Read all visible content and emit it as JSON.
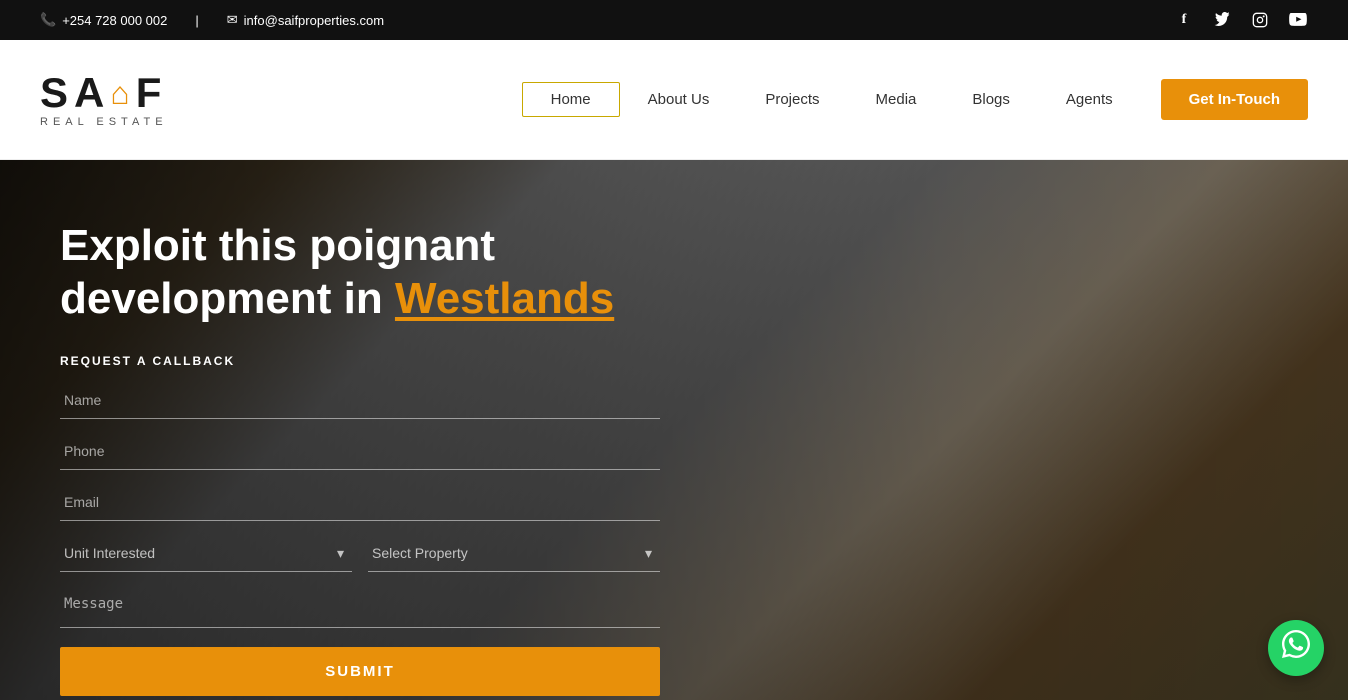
{
  "topbar": {
    "phone": "+254 728 000 002",
    "email": "info@saifproperties.com",
    "phone_icon": "📞",
    "email_icon": "✉",
    "socials": [
      {
        "name": "facebook",
        "icon": "f"
      },
      {
        "name": "twitter",
        "icon": "🐦"
      },
      {
        "name": "instagram",
        "icon": "📷"
      },
      {
        "name": "youtube",
        "icon": "▶"
      }
    ]
  },
  "header": {
    "logo_main": "SAIF",
    "logo_sub": "REAL ESTATE",
    "nav_items": [
      {
        "label": "Home",
        "active": true
      },
      {
        "label": "About Us",
        "active": false
      },
      {
        "label": "Projects",
        "active": false
      },
      {
        "label": "Media",
        "active": false
      },
      {
        "label": "Blogs",
        "active": false
      },
      {
        "label": "Agents",
        "active": false
      }
    ],
    "cta": "Get In-Touch"
  },
  "hero": {
    "title_part1": "Exploit this poignant",
    "title_part2": "development in ",
    "title_highlight": "Westlands"
  },
  "form": {
    "title": "REQUEST A CALLBACK",
    "name_placeholder": "Name",
    "phone_placeholder": "Phone",
    "email_placeholder": "Email",
    "unit_label": "Unit Interested",
    "property_label": "Select Property",
    "message_placeholder": "Message",
    "submit_label": "SUBMIT"
  },
  "whatsapp": {
    "icon": "💬"
  }
}
